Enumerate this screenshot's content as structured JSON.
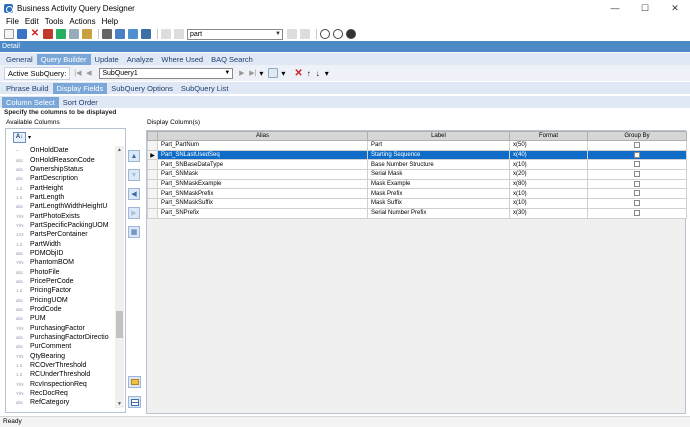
{
  "window": {
    "title": "Business Activity Query Designer",
    "controls": [
      "—",
      "☐",
      "✕"
    ]
  },
  "menu": [
    "File",
    "Edit",
    "Tools",
    "Actions",
    "Help"
  ],
  "toolbar": {
    "search_value": "part"
  },
  "detail_label": "Detail",
  "main_tabs": [
    "General",
    "Query Builder",
    "Update",
    "Analyze",
    "Where Used",
    "BAQ Search"
  ],
  "main_tabs_active": "Query Builder",
  "subquery": {
    "label": "Active SubQuery:",
    "value": "SubQuery1"
  },
  "sub_tabs": [
    "Phrase Build",
    "Display Fields",
    "SubQuery Options",
    "SubQuery List"
  ],
  "sub_tabs2": [
    "Column Select",
    "Sort Order"
  ],
  "spec_text": "Specify the columns to be displayed",
  "available_label": "Available Columns",
  "display_label": "Display Column(s)",
  "sort_btn": "A↓",
  "fields": [
    {
      "type": "~",
      "name": "OnHoldDate"
    },
    {
      "type": "abc",
      "name": "OnHoldReasonCode"
    },
    {
      "type": "abc",
      "name": "OwnershipStatus"
    },
    {
      "type": "abc",
      "name": "PartDescription"
    },
    {
      "type": "1.2",
      "name": "PartHeight"
    },
    {
      "type": "1.2",
      "name": "PartLength"
    },
    {
      "type": "abc",
      "name": "PartLengthWidthHeightU"
    },
    {
      "type": "Y/N",
      "name": "PartPhotoExists"
    },
    {
      "type": "Y/N",
      "name": "PartSpecificPackingUOM"
    },
    {
      "type": "123",
      "name": "PartsPerContainer"
    },
    {
      "type": "1.2",
      "name": "PartWidth"
    },
    {
      "type": "abc",
      "name": "PDMObjID"
    },
    {
      "type": "Y/N",
      "name": "PhantomBOM"
    },
    {
      "type": "abc",
      "name": "PhotoFile"
    },
    {
      "type": "abc",
      "name": "PricePerCode"
    },
    {
      "type": "1.2",
      "name": "PricingFactor"
    },
    {
      "type": "abc",
      "name": "PricingUOM"
    },
    {
      "type": "abc",
      "name": "ProdCode"
    },
    {
      "type": "abc",
      "name": "PUM"
    },
    {
      "type": "Y/N",
      "name": "PurchasingFactor"
    },
    {
      "type": "abc",
      "name": "PurchasingFactorDirectio"
    },
    {
      "type": "abc",
      "name": "PurComment"
    },
    {
      "type": "Y/N",
      "name": "QtyBearing"
    },
    {
      "type": "1.2",
      "name": "RCOverThreshold"
    },
    {
      "type": "1.2",
      "name": "RCUnderThreshold"
    },
    {
      "type": "Y/N",
      "name": "RcvInspectionReq"
    },
    {
      "type": "Y/N",
      "name": "RecDocReq"
    },
    {
      "type": "abc",
      "name": "RefCategory"
    }
  ],
  "grid": {
    "headers": [
      "Alias",
      "Label",
      "Format",
      "Group By"
    ],
    "rows": [
      {
        "alias": "Part_PartNum",
        "label": "Part",
        "format": "x(50)",
        "selected": false
      },
      {
        "alias": "Part_SNLastUsedSeq",
        "label": "Starting Sequence",
        "format": "x(40)",
        "selected": true
      },
      {
        "alias": "Part_SNBaseDataType",
        "label": "Base Number Structure",
        "format": "x(10)",
        "selected": false
      },
      {
        "alias": "Part_SNMask",
        "label": "Serial Mask",
        "format": "x(20)",
        "selected": false
      },
      {
        "alias": "Part_SNMaskExample",
        "label": "Mask Example",
        "format": "x(80)",
        "selected": false
      },
      {
        "alias": "Part_SNMaskPrefix",
        "label": "Mask Prefix",
        "format": "x(10)",
        "selected": false
      },
      {
        "alias": "Part_SNMaskSuffix",
        "label": "Mask Suffix",
        "format": "x(10)",
        "selected": false
      },
      {
        "alias": "Part_SNPrefix",
        "label": "Serial Number Prefix",
        "format": "x(30)",
        "selected": false
      }
    ]
  },
  "status": "Ready",
  "colors": {
    "accent": "#4b8ac5",
    "selection": "#0f6dc9",
    "tab_active": "#7ba7d8"
  }
}
